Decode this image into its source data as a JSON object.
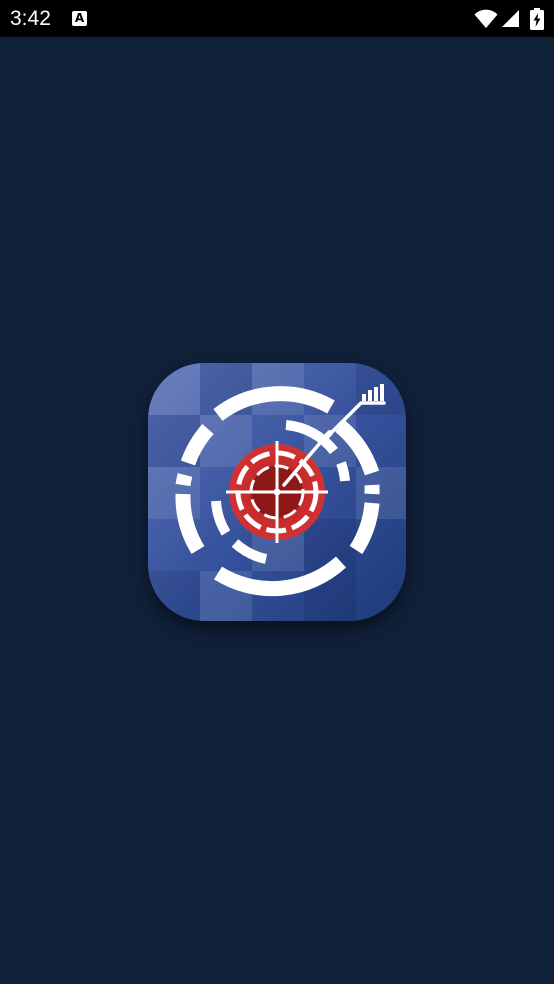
{
  "status_bar": {
    "time": "3:42",
    "notification_glyph": "A",
    "icons": [
      "wifi-icon",
      "cell-signal-icon",
      "battery-charging-icon"
    ]
  },
  "splash": {
    "logo_icon": "target-crosshair-analytics-icon",
    "colors": {
      "background": "#102039",
      "icon_tile_light": "#5b71b8",
      "icon_tile_dark": "#1d3a78",
      "target_red": "#c72a2a",
      "target_center": "#8e1818",
      "ring_white": "#ffffff"
    }
  }
}
